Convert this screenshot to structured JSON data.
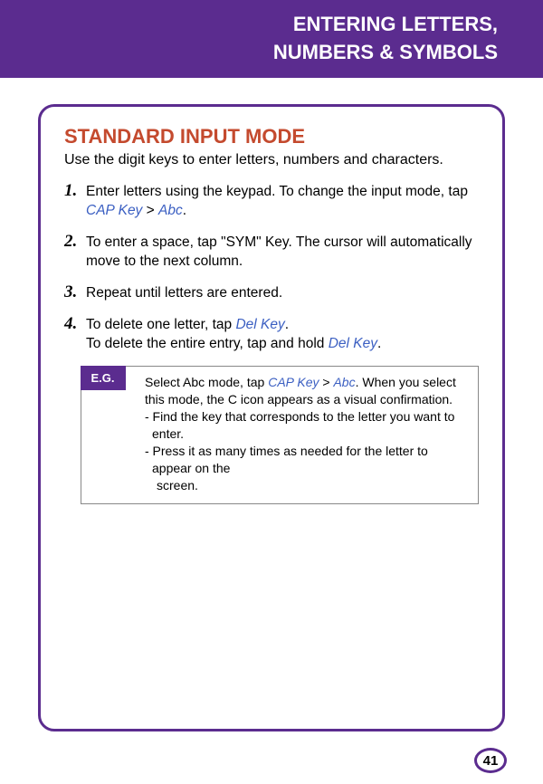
{
  "header": {
    "line1": "ENTERING LETTERS,",
    "line2": "NUMBERS & SYMBOLS"
  },
  "main": {
    "title": "STANDARD INPUT MODE",
    "intro": "Use the digit keys to enter letters, numbers and characters.",
    "steps": [
      {
        "num": "1.",
        "pre": "Enter letters using the keypad. To change the input mode, tap ",
        "key1": "CAP Key",
        "mid": " > ",
        "key2": "Abc",
        "post": "."
      },
      {
        "num": "2.",
        "text": "To enter a space, tap \"SYM\" Key. The cursor will automatically move to the next column."
      },
      {
        "num": "3.",
        "text": "Repeat until letters are entered."
      },
      {
        "num": "4.",
        "line1_pre": "To delete one letter, tap ",
        "line1_key": "Del Key",
        "line1_post": ".",
        "line2_pre": "To delete the entire entry, tap and hold ",
        "line2_key": "Del Key",
        "line2_post": "."
      }
    ],
    "eg": {
      "badge": "E.G.",
      "line1_pre": "Select Abc mode, tap ",
      "line1_k1": "CAP Key",
      "line1_mid": " > ",
      "line1_k2": "Abc",
      "line1_post": ". When you select this mode, the C icon appears as a visual confirmation.",
      "b1": "- Find the key that corresponds to the letter you want to enter.",
      "b2a": "- Press it as many times as needed for the letter to appear on the",
      "b2b": "screen."
    }
  },
  "page_number": "41"
}
